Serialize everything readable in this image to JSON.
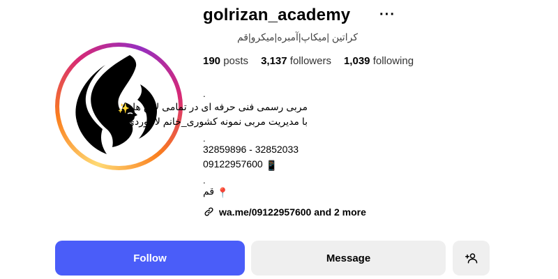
{
  "profile": {
    "username": "golrizan_academy",
    "more_label": "···",
    "category": "کراتین |میکاپ|آمبره|میکرو|قم"
  },
  "stats": {
    "posts_count": "190",
    "posts_label": "posts",
    "followers_count": "3,137",
    "followers_label": "followers",
    "following_count": "1,039",
    "following_label": "following"
  },
  "bio": {
    "dot1": ".",
    "line1": "مربی رسمی فنی حرفه ای در تمامی لاین ها",
    "line1_emoji": "✨",
    "line2": "با مدیریت مربی نمونه کشوری_خانم لاجوردی",
    "dot2": ".",
    "phone1": "32859896 - 32852033",
    "phone2": "09122957600",
    "phone2_emoji": "📱",
    "dot3": ".",
    "location": "قم",
    "location_emoji": "📍"
  },
  "link": {
    "icon": "link-icon",
    "text": "wa.me/09122957600 and 2 more"
  },
  "actions": {
    "follow_label": "Follow",
    "message_label": "Message",
    "add_user_icon": "add-user-icon"
  },
  "colors": {
    "follow_button": "#4a5df9",
    "secondary_button": "#efefef"
  }
}
